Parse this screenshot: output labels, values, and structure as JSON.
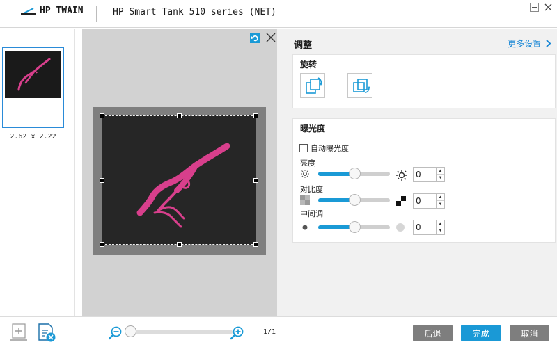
{
  "app": {
    "logo_text": "HP TWAIN",
    "title": "HP Smart Tank 510 series (NET)"
  },
  "thumbnail": {
    "size_label": "2.62  x  2.22"
  },
  "panel": {
    "title": "调整",
    "more_settings": "更多设置"
  },
  "rotate": {
    "title": "旋转"
  },
  "exposure": {
    "title": "曝光度",
    "auto_label": "自动曝光度",
    "auto_checked": false,
    "brightness": {
      "label": "亮度",
      "value": "0",
      "level": 0.5
    },
    "contrast": {
      "label": "对比度",
      "value": "0",
      "level": 0.5
    },
    "midtone": {
      "label": "中间调",
      "value": "0",
      "level": 0.5
    }
  },
  "bottom": {
    "page_count": "1/1",
    "zoom_level": 0,
    "back_label": "后退",
    "done_label": "完成",
    "cancel_label": "取消"
  },
  "colors": {
    "accent": "#1a99d6",
    "selection": "#2a8bd8",
    "scan_subject": "#d83f8c",
    "button_gray": "#7e7e7e"
  }
}
